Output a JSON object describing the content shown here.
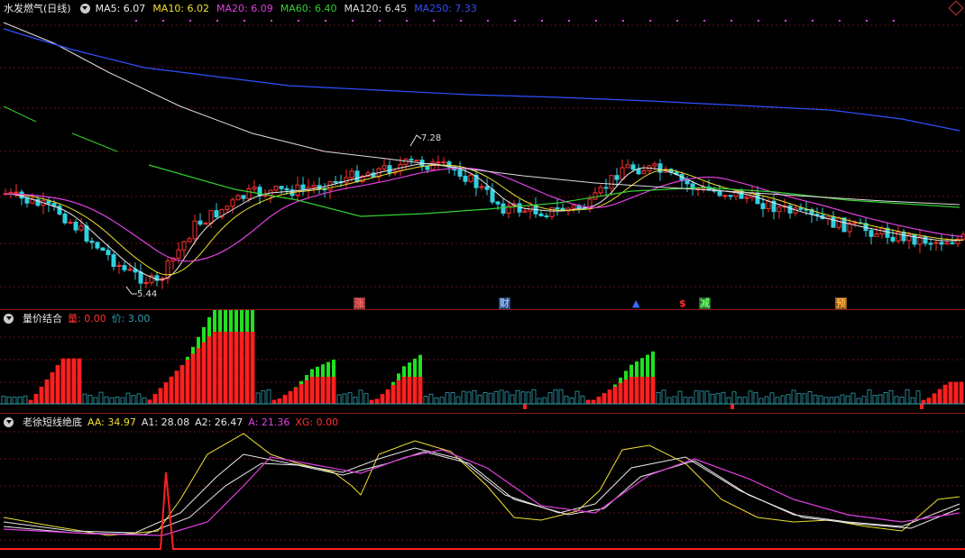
{
  "main": {
    "title": "水发燃气(日线)",
    "indicators": [
      {
        "label": "MA5: 6.07",
        "color": "#e8e8e8"
      },
      {
        "label": "MA10: 6.02",
        "color": "#f0e030"
      },
      {
        "label": "MA20: 6.09",
        "color": "#e040e0"
      },
      {
        "label": "MA60: 6.40",
        "color": "#30d030"
      },
      {
        "label": "MA120: 6.45",
        "color": "#dddddd"
      },
      {
        "label": "MA250: 7.33",
        "color": "#3050ff"
      }
    ],
    "high_label": "7.28",
    "low_label": "5.44",
    "markers": [
      {
        "text": "涨",
        "bg": "#8a3a3a",
        "fg": "#ff6060"
      },
      {
        "text": "财",
        "bg": "#304070",
        "fg": "#90c0ff"
      },
      {
        "text": "▲",
        "bg": "#000000",
        "fg": "#3070ff"
      },
      {
        "text": "$",
        "bg": "#000000",
        "fg": "#ff3030"
      },
      {
        "text": "减",
        "bg": "#306030",
        "fg": "#60ff60"
      },
      {
        "text": "预",
        "bg": "#8a5a20",
        "fg": "#ffb040"
      }
    ]
  },
  "volume": {
    "title": "量价结合",
    "items": [
      {
        "label": "量: 0.00",
        "color": "#ff3030"
      },
      {
        "label": "价: 3.00",
        "color": "#30a0b0"
      }
    ]
  },
  "osc": {
    "title": "老徐短线绝底",
    "items": [
      {
        "label": "AA: 34.97",
        "color": "#f0e030"
      },
      {
        "label": "A1: 28.08",
        "color": "#e8e8e8"
      },
      {
        "label": "A2: 26.47",
        "color": "#e8e8e8"
      },
      {
        "label": "A: 21.36",
        "color": "#e040e0"
      },
      {
        "label": "XG: 0.00",
        "color": "#ff3030"
      }
    ]
  },
  "colors": {
    "up": "#ff3030",
    "down": "#30d0e0",
    "bg": "#000000",
    "grid": "#6a1010"
  }
}
